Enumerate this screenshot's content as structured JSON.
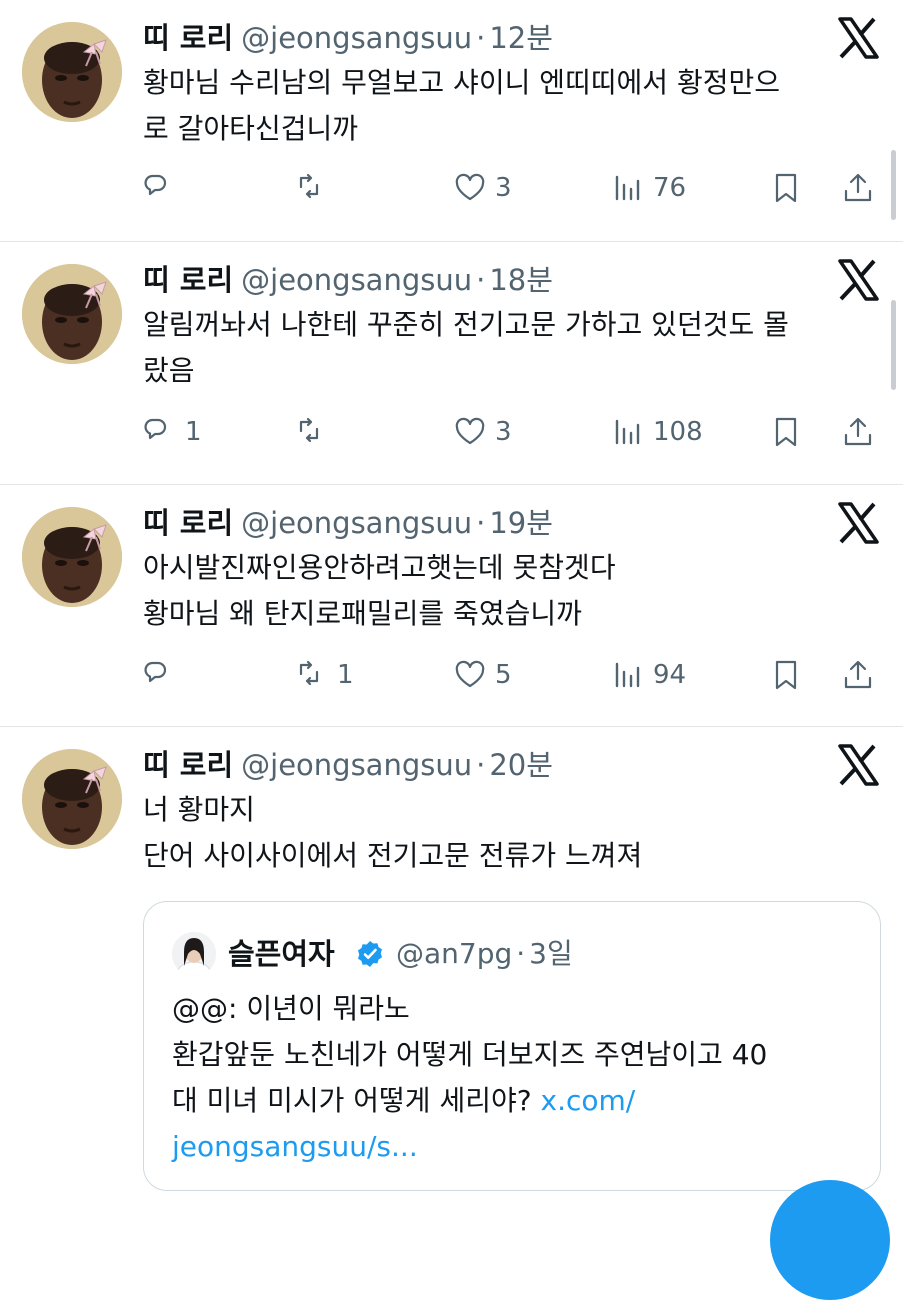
{
  "tweets": [
    {
      "name": "띠 로리",
      "handle": "@jeongsangsuu",
      "time": "12분",
      "text_lines": [
        "황마님 수리남의 무얼보고 샤이니 엔띠띠에서 황정만으",
        "로 갈아타신겁니까"
      ],
      "replies": "",
      "retweets": "",
      "likes": "3",
      "views": "76"
    },
    {
      "name": "띠 로리",
      "handle": "@jeongsangsuu",
      "time": "18분",
      "text_lines": [
        "알림꺼놔서 나한테 꾸준히 전기고문 가하고 있던것도 몰",
        "랐음"
      ],
      "replies": "1",
      "retweets": "",
      "likes": "3",
      "views": "108"
    },
    {
      "name": "띠 로리",
      "handle": "@jeongsangsuu",
      "time": "19분",
      "text_lines": [
        "아시발진짜인용안하려고햇는데 못참겟다",
        "황마님 왜 탄지로패밀리를 죽였습니까"
      ],
      "replies": "",
      "retweets": "1",
      "likes": "5",
      "views": "94"
    },
    {
      "name": "띠 로리",
      "handle": "@jeongsangsuu",
      "time": "20분",
      "text_lines": [
        "너 황마지",
        "단어 사이사이에서 전기고문 전류가 느껴져"
      ],
      "replies": "",
      "retweets": "",
      "likes": "",
      "views": ""
    }
  ],
  "quote": {
    "name": "슬픈여자",
    "handle": "@an7pg",
    "time": "3일",
    "line1": "@@: 이년이 뭐라노",
    "line2": "환갑앞둔 노친네가 어떻게 더보지즈 주연남이고 40",
    "line3_text": "대 미녀 미시가 어떻게 세리야? ",
    "line3_link": "x.com/",
    "line4_link": "jeongsangsuu/s..."
  },
  "separator": "·",
  "colors": {
    "text": "#0f1419",
    "secondary": "#536471",
    "link": "#1d9bf0",
    "divider": "#e3e6e9"
  },
  "icons": [
    "x-logo-icon",
    "reply-icon",
    "retweet-icon",
    "like-icon",
    "views-icon",
    "bookmark-icon",
    "share-icon",
    "verified-badge-icon"
  ]
}
